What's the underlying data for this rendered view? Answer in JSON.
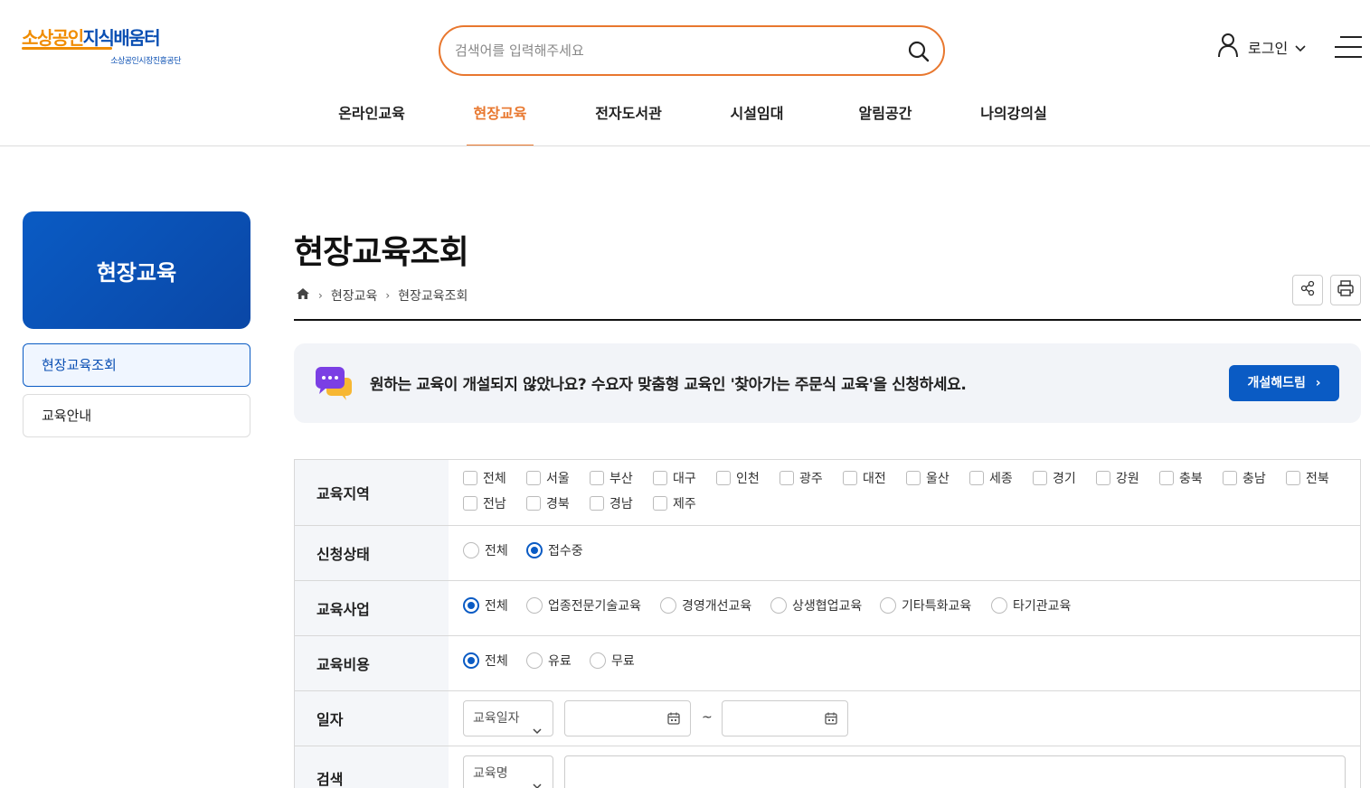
{
  "header": {
    "logo_main_orange": "소상공인",
    "logo_main_blue": "지식배움터",
    "logo_sub": "소상공인시장진흥공단",
    "search_placeholder": "검색어를 입력해주세요",
    "login_label": "로그인"
  },
  "gnb": {
    "items": [
      "온라인교육",
      "현장교육",
      "전자도서관",
      "시설임대",
      "알림공간",
      "나의강의실"
    ],
    "active_index": 1
  },
  "sidebar": {
    "title": "현장교육",
    "items": [
      "현장교육조회",
      "교육안내"
    ],
    "active_index": 0
  },
  "main": {
    "title": "현장교육조회",
    "breadcrumb": [
      "현장교육",
      "현장교육조회"
    ]
  },
  "banner": {
    "text": "원하는 교육이 개설되지 않았나요? 수요자 맞춤형 교육인 '찾아가는 주문식 교육'을 신청하세요.",
    "button_label": "개설해드림"
  },
  "filter": {
    "region": {
      "label": "교육지역",
      "options": [
        "전체",
        "서울",
        "부산",
        "대구",
        "인천",
        "광주",
        "대전",
        "울산",
        "세종",
        "경기",
        "강원",
        "충북",
        "충남",
        "전북",
        "전남",
        "경북",
        "경남",
        "제주"
      ]
    },
    "status": {
      "label": "신청상태",
      "options": [
        "전체",
        "접수중"
      ],
      "selected": "접수중"
    },
    "business": {
      "label": "교육사업",
      "options": [
        "전체",
        "업종전문기술교육",
        "경영개선교육",
        "상생협업교육",
        "기타특화교육",
        "타기관교육"
      ],
      "selected": "전체"
    },
    "cost": {
      "label": "교육비용",
      "options": [
        "전체",
        "유료",
        "무료"
      ],
      "selected": "전체"
    },
    "date": {
      "label": "일자",
      "type_select": "교육일자",
      "separator": "~"
    },
    "search": {
      "label": "검색",
      "type_select": "교육명"
    }
  },
  "colors": {
    "accent": "#e8772e",
    "primary": "#0a5bc4"
  }
}
